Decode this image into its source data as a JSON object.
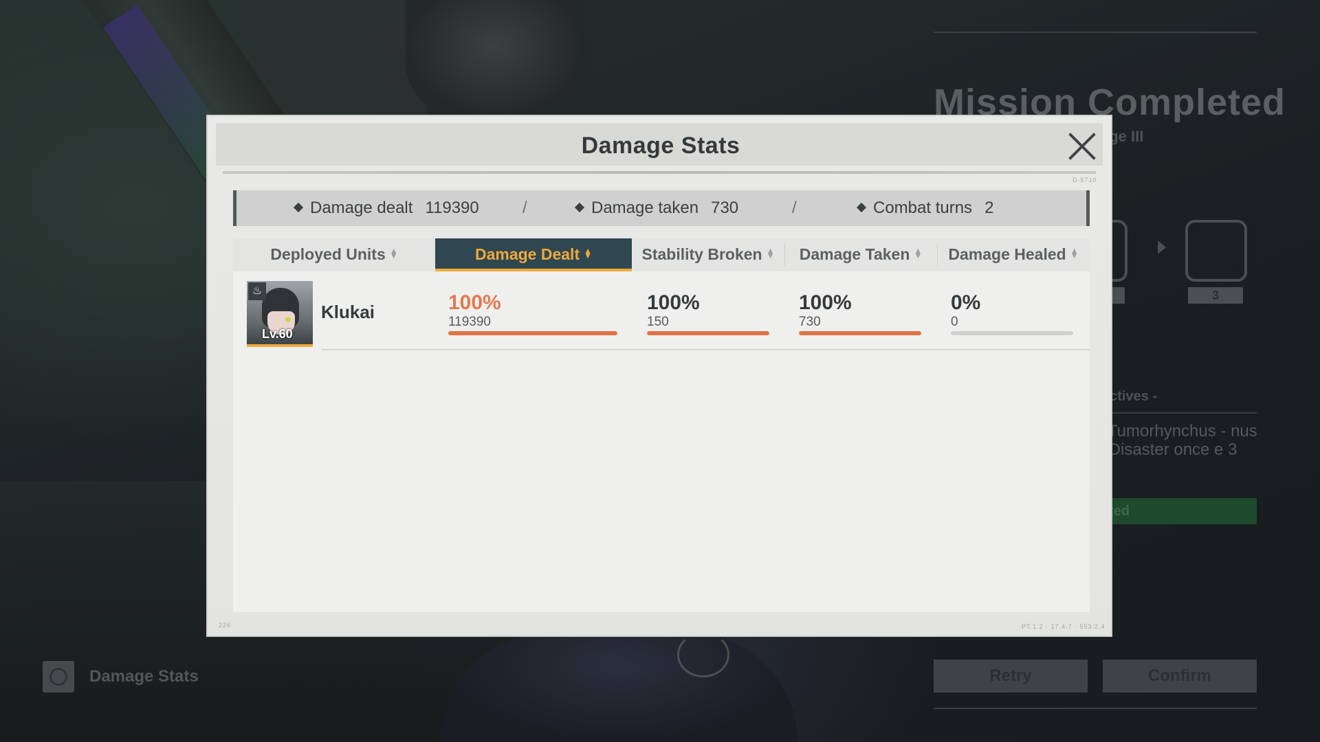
{
  "background": {
    "mission_title": "Mission Completed",
    "mission_sub": "ege III",
    "rank_value": "3",
    "objectives_head": "ectives -",
    "objective_text": ": Tumorhynchus - nus - Disaster once e 3",
    "objective_status": "ted",
    "retry_label": "Retry",
    "confirm_label": "Confirm",
    "bottom_label": "Damage Stats"
  },
  "modal": {
    "title": "Damage Stats",
    "summary": {
      "damage_dealt_label": "Damage dealt",
      "damage_dealt_value": "119390",
      "damage_taken_label": "Damage taken",
      "damage_taken_value": "730",
      "combat_turns_label": "Combat turns",
      "combat_turns_value": "2",
      "separator": "/"
    },
    "tabs": [
      {
        "label": "Deployed Units",
        "active": false
      },
      {
        "label": "Damage Dealt",
        "active": true
      },
      {
        "label": "Stability Broken",
        "active": false
      },
      {
        "label": "Damage Taken",
        "active": false
      },
      {
        "label": "Damage Healed",
        "active": false
      }
    ],
    "units": [
      {
        "name": "Klukai",
        "level": "Lv.60",
        "damage_dealt": {
          "percent": "100%",
          "value": "119390",
          "fill": 1.0
        },
        "stability_broken": {
          "percent": "100%",
          "value": "150",
          "fill": 1.0
        },
        "damage_taken": {
          "percent": "100%",
          "value": "730",
          "fill": 1.0
        },
        "damage_healed": {
          "percent": "0%",
          "value": "0",
          "fill": 0.0
        }
      }
    ]
  },
  "colors": {
    "accent": "#f0a93a",
    "highlight_percent": "#e37a4f",
    "bar_fill": "#df7446",
    "active_tab_bg": "#2f4751"
  },
  "icons": [
    "close-icon",
    "diamond-icon",
    "sort-icon",
    "faction-icon",
    "damage-stats-icon"
  ]
}
